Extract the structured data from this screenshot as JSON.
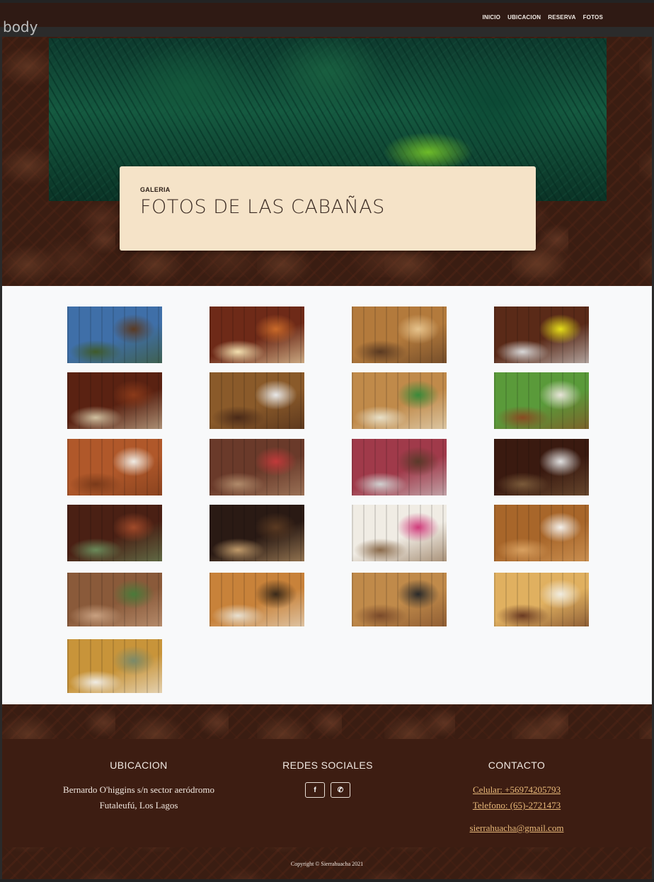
{
  "debug_label": "body",
  "nav": {
    "items": [
      "INICIO",
      "UBICACION",
      "RESERVA",
      "FOTOS"
    ]
  },
  "hero": {
    "kicker": "GALERIA",
    "title": "FOTOS DE LAS CABAÑAS"
  },
  "gallery": {
    "photos": [
      {
        "scene": "cabin-exterior-mountains",
        "colors": [
          "#3f6fa8",
          "#5a3a22",
          "#3f5a2a"
        ]
      },
      {
        "scene": "living-room-wood",
        "colors": [
          "#6e2a18",
          "#c96a2a",
          "#f3e0b0"
        ]
      },
      {
        "scene": "kitchen-wood",
        "colors": [
          "#b37a3c",
          "#e6c38c",
          "#5a3a22"
        ]
      },
      {
        "scene": "kitchen-yellow-curtain",
        "colors": [
          "#5a2a18",
          "#e6df1a",
          "#d8d8d8"
        ]
      },
      {
        "scene": "dining-wood-door",
        "colors": [
          "#5a2212",
          "#8a3a1a",
          "#d0c0a0"
        ]
      },
      {
        "scene": "kitchen-fridge",
        "colors": [
          "#8a5a2a",
          "#e8e8e8",
          "#4a2a18"
        ]
      },
      {
        "scene": "bedroom-green",
        "colors": [
          "#c08a4a",
          "#3a8a3a",
          "#e8e0c8"
        ]
      },
      {
        "scene": "bedroom-green-2",
        "colors": [
          "#5a9a3a",
          "#e8e4d8",
          "#8a4a22"
        ]
      },
      {
        "scene": "bathroom-door",
        "colors": [
          "#b0582a",
          "#f0ece4",
          "#7a3a1a"
        ]
      },
      {
        "scene": "living-dining-red",
        "colors": [
          "#6a3a2a",
          "#c03a3a",
          "#b08a6a"
        ]
      },
      {
        "scene": "kitchen-pink",
        "colors": [
          "#a03a4a",
          "#5a3a2a",
          "#d0d0d0"
        ]
      },
      {
        "scene": "kitchen-window-dark",
        "colors": [
          "#3a1a10",
          "#e0e0e0",
          "#7a5a3a"
        ]
      },
      {
        "scene": "bedroom-striped",
        "colors": [
          "#4a2014",
          "#a04a2a",
          "#6a8a5a"
        ]
      },
      {
        "scene": "bedroom-dark",
        "colors": [
          "#2a1a14",
          "#5a3a22",
          "#c09a6a"
        ]
      },
      {
        "scene": "hallway-pink",
        "colors": [
          "#f0ece4",
          "#d03a7a",
          "#8a6a4a"
        ]
      },
      {
        "scene": "bathroom-vanity",
        "colors": [
          "#a8662a",
          "#f4f0ea",
          "#d8a060"
        ]
      },
      {
        "scene": "cabin-deck-exterior",
        "colors": [
          "#8a5a3a",
          "#4a7a3a",
          "#c8a080"
        ]
      },
      {
        "scene": "kitchen-tv",
        "colors": [
          "#c8823a",
          "#3a2a1a",
          "#e8e0d0"
        ]
      },
      {
        "scene": "living-kitchen-stove",
        "colors": [
          "#c08a4a",
          "#2a2a2a",
          "#7a4a2a"
        ]
      },
      {
        "scene": "living-room-sofa",
        "colors": [
          "#e0b060",
          "#f0ece0",
          "#6a3a22"
        ]
      },
      {
        "scene": "bedroom-twin-beds",
        "colors": [
          "#c8943a",
          "#7a8a6a",
          "#f0ece4"
        ]
      }
    ]
  },
  "footer": {
    "ubicacion": {
      "heading": "UBICACION",
      "line1": "Bernardo O'higgins s/n sector aeródromo",
      "line2": "Futaleufú, Los Lagos"
    },
    "redes": {
      "heading": "REDES SOCIALES",
      "facebook_glyph": "f",
      "whatsapp_glyph": "✆"
    },
    "contacto": {
      "heading": "CONTACTO",
      "celular": "Celular: +56974205793",
      "telefono": "Telefono: (65)-2721473",
      "email": "sierrahuacha@gmail.com"
    },
    "copyright": "Copyright © Sierrahuacha 2021"
  },
  "colors": {
    "topbar": "#2f1a14",
    "card": "#f5e3c8",
    "gallery_bg": "#f8f9fa",
    "footer": "#3d1d12",
    "link": "#e8b97a"
  }
}
